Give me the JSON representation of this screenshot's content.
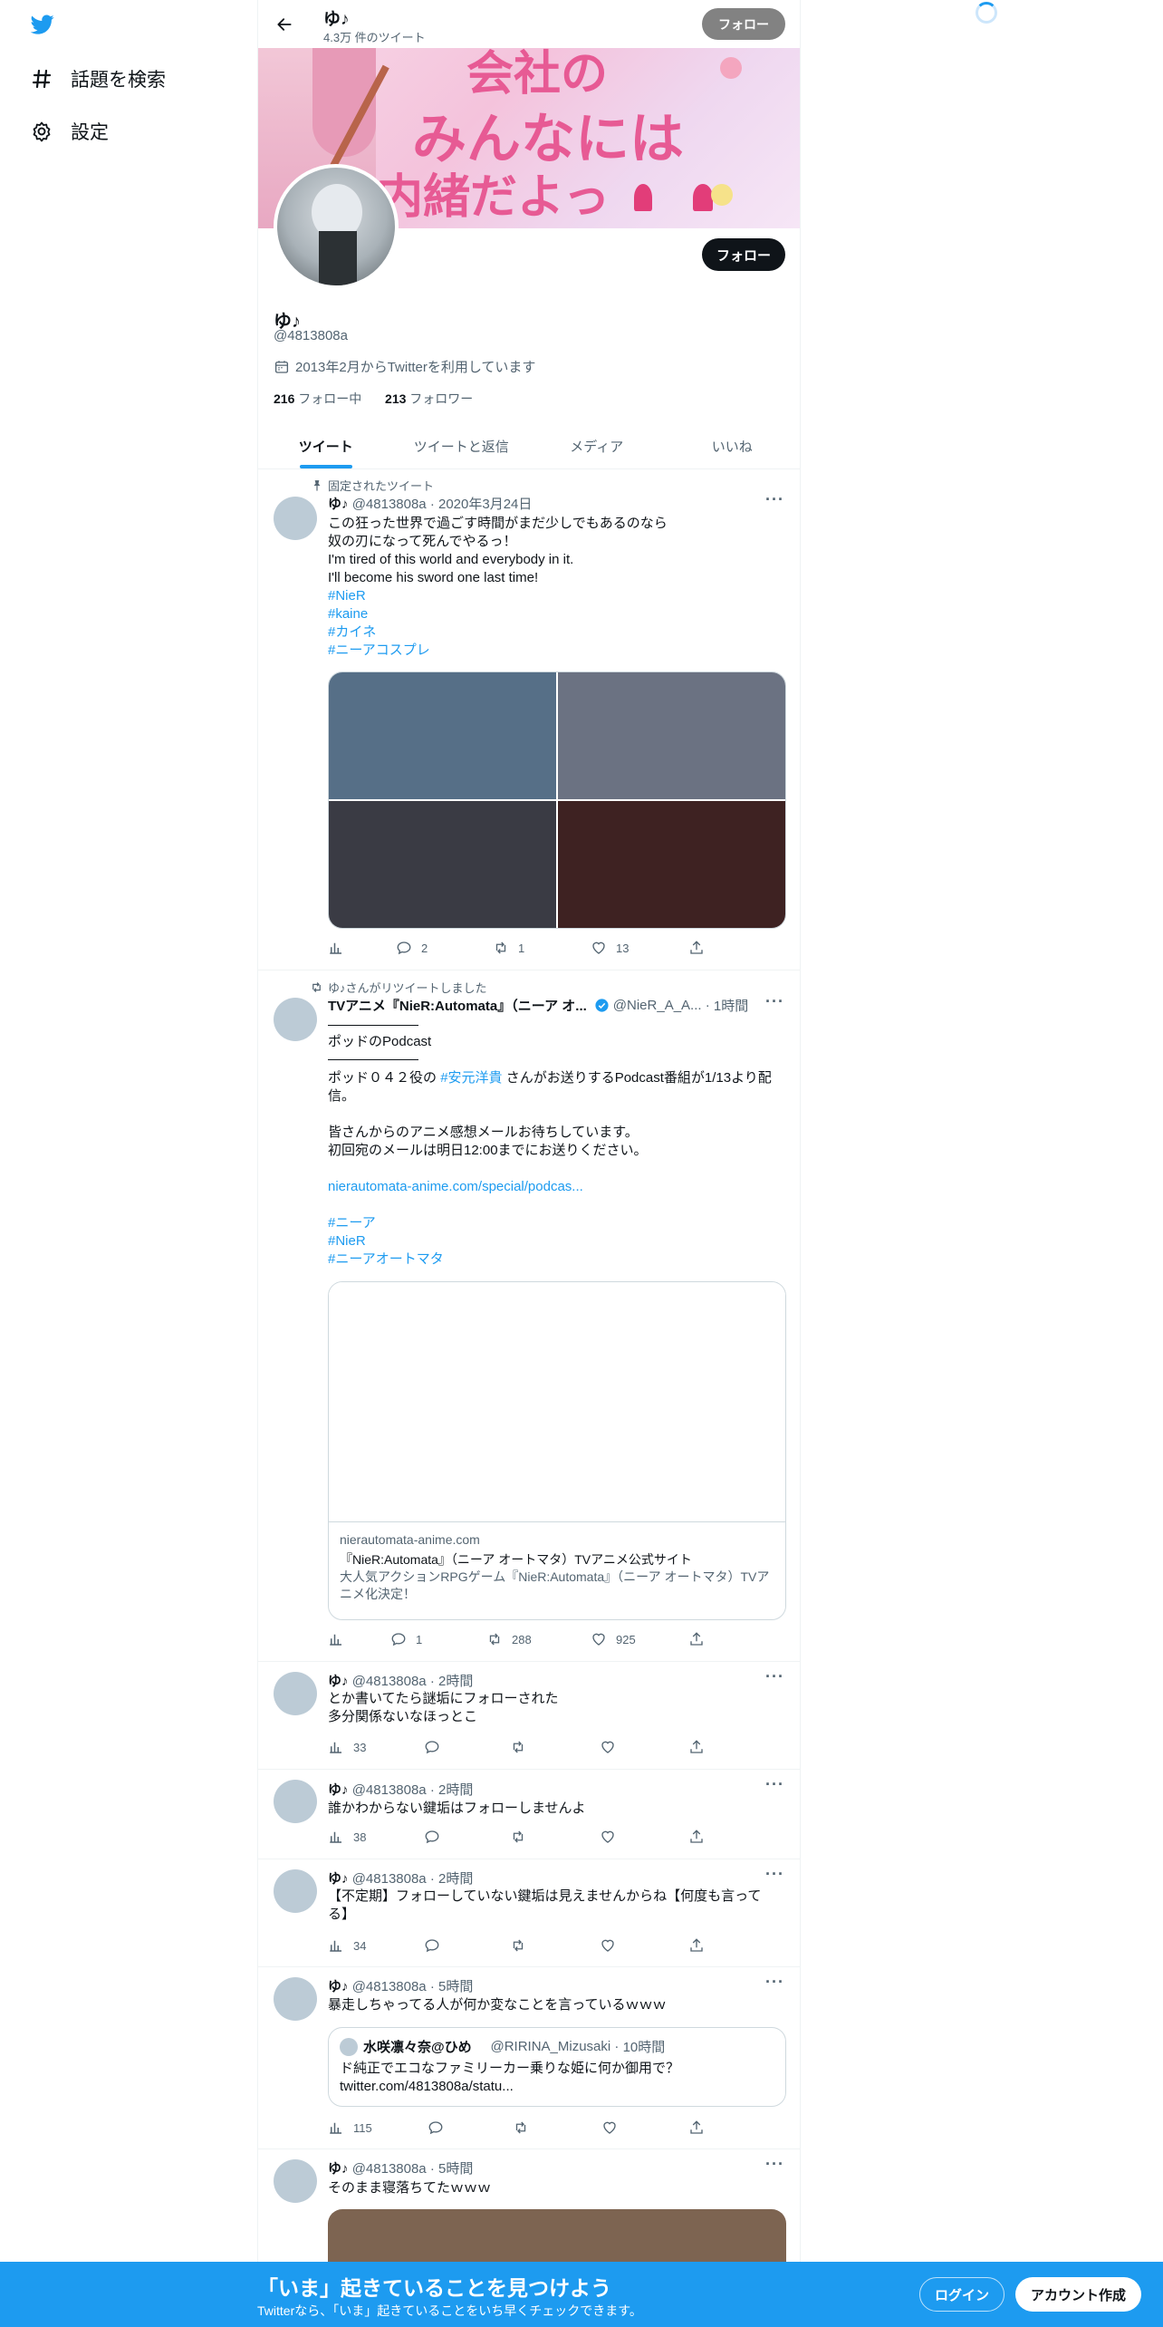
{
  "sidebar": {
    "items": [
      {
        "label": "話題を検索",
        "icon": "hashtag-icon"
      },
      {
        "label": "設定",
        "icon": "gear-icon"
      }
    ]
  },
  "header": {
    "name": "ゆ♪",
    "tweet_count": "4.3万 件のツイート",
    "follow_label": "フォロー"
  },
  "banner": {
    "line1": "会社の",
    "line2": "みんなには",
    "line3": "内緒だよっ"
  },
  "profile": {
    "name": "ゆ♪",
    "handle": "@4813808a",
    "joined": "2013年2月からTwitterを利用しています",
    "following_count": "216",
    "following_label": "フォロー中",
    "followers_count": "213",
    "followers_label": "フォロワー",
    "follow_label": "フォロー"
  },
  "tabs": [
    "ツイート",
    "ツイートと返信",
    "メディア",
    "いいね"
  ],
  "tweets": [
    {
      "context": "固定されたツイート",
      "name": "ゆ♪",
      "handle": "@4813808a",
      "sep": "·",
      "time": "2020年3月24日",
      "lines": [
        "この狂った世界で過ごす時間がまだ少しでもあるのなら",
        "奴の刃になって死んでやるっ！",
        "I'm tired of this world and everybody in it.",
        "I'll become his sword one last time!"
      ],
      "tags": [
        "#NieR",
        "#kaine",
        "#カイネ",
        "#ニーアコスプレ"
      ],
      "media_colors": [
        "#566f87",
        "#6b7282",
        "#3a3b44",
        "#3e2222"
      ],
      "reply": "2",
      "retweet": "1",
      "like": "13"
    },
    {
      "context": "ゆ♪さんがリツイートしました",
      "name": "TVアニメ『NieR:Automata』（ニーア オ...",
      "handle": "@NieR_A_A...",
      "sep": "·",
      "time": "1時間",
      "title": "ポッドのPodcast",
      "p1a": "ポッド０４２役の",
      "p1tag": "#安元洋貴",
      "p1b": " さんがお送りするPodcast番組が1/13より配信。",
      "p2": [
        "皆さんからのアニメ感想メールお待ちしています。",
        "初回宛のメールは明日12:00までにお送りください。"
      ],
      "url": "nierautomata-anime.com/special/podcas...",
      "tags": [
        "#ニーア",
        "#NieR",
        "#ニーアオートマタ"
      ],
      "card": {
        "domain": "nierautomata-anime.com",
        "title": "『NieR:Automata』（ニーア オートマタ）TVアニメ公式サイト",
        "desc": "大人気アクションRPGゲーム『NieR:Automata』（ニーア オートマタ）TVアニメ化決定！"
      },
      "reply": "1",
      "retweet": "288",
      "like": "925"
    },
    {
      "name": "ゆ♪",
      "handle": "@4813808a",
      "sep": "·",
      "time": "2時間",
      "lines": [
        "とか書いてたら謎垢にフォローされた",
        "多分関係ないなほっとこ"
      ],
      "views": "33"
    },
    {
      "name": "ゆ♪",
      "handle": "@4813808a",
      "sep": "·",
      "time": "2時間",
      "lines": [
        "誰かわからない鍵垢はフォローしませんよ"
      ],
      "views": "38"
    },
    {
      "name": "ゆ♪",
      "handle": "@4813808a",
      "sep": "·",
      "time": "2時間",
      "lines": [
        "【不定期】フォローしていない鍵垢は見えませんからね【何度も言って",
        "る】"
      ],
      "views": "34"
    },
    {
      "name": "ゆ♪",
      "handle": "@4813808a",
      "sep": "·",
      "time": "5時間",
      "lines": [
        "暴走しちゃってる人が何か変なことを言っているｗｗｗ"
      ],
      "quote": {
        "name": "水咲凛々奈@ひめ",
        "handle": "@RIRINA_Mizusaki",
        "sep": "·",
        "time": "10時間",
        "text": "ド純正でエコなファミリーカー乗りな姫に何か御用で？",
        "url": "twitter.com/4813808a/statu..."
      },
      "views": "115"
    },
    {
      "name": "ゆ♪",
      "handle": "@4813808a",
      "sep": "·",
      "time": "5時間",
      "lines": [
        "そのまま寝落ちてたｗｗｗ"
      ],
      "media_color": "#7d6451"
    }
  ],
  "bottom_bar": {
    "title": "「いま」起きていることを見つけよう",
    "subtitle": "Twitterなら、「いま」起きていることをいち早くチェックできます。",
    "login": "ログイン",
    "signup": "アカウント作成"
  },
  "colors": {
    "accent": "#1d9bf0",
    "text": "#0f1419",
    "muted": "#536471"
  }
}
